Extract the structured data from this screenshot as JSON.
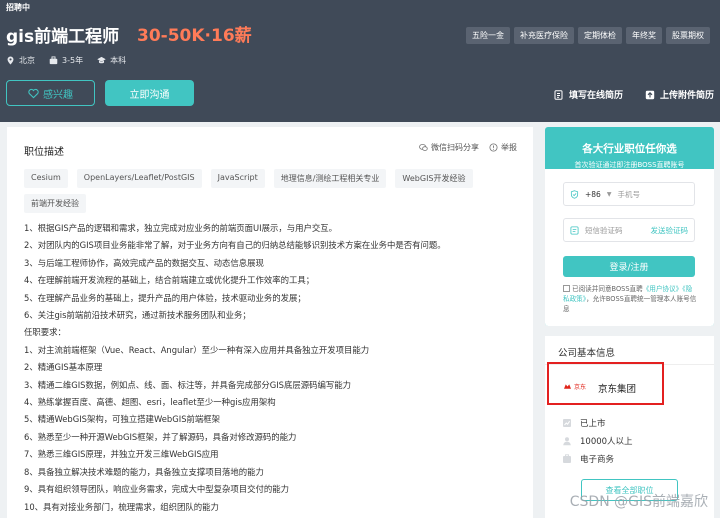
{
  "header": {
    "status": "招聘中",
    "job_title": "gis前端工程师",
    "salary": "30-50K·16薪",
    "meta": {
      "city": "北京",
      "experience": "3-5年",
      "education": "本科"
    },
    "benefits": [
      "五险一金",
      "补充医疗保险",
      "定期体检",
      "年终奖",
      "股票期权"
    ],
    "buttons": {
      "interest": "感兴趣",
      "chat": "立即沟通"
    },
    "resume_links": {
      "online": "填写在线简历",
      "upload": "上传附件简历"
    }
  },
  "job_detail": {
    "section_title": "职位描述",
    "share_label": "微信扫码分享",
    "report_label": "举报",
    "tags": [
      "Cesium",
      "OpenLayers/Leaflet/PostGIS",
      "JavaScript",
      "地理信息/测绘工程相关专业",
      "WebGIS开发经验",
      "前端开发经验"
    ],
    "description": [
      "1、根据GIS产品的逻辑和需求，独立完成对应业务的前端页面UI展示，与用户交互。",
      "2、对团队内的GIS项目业务能非常了解，对于业务方向有自己的归纳总结能够识别技术方案在业务中是否有问题。",
      "3、与后端工程师协作，高效完成产品的数据交互、动态信息展现",
      "4、在理解前端开发流程的基础上，结合前端建立或优化提升工作效率的工具；",
      "5、在理解产品业务的基础上，提升产品的用户体验，技术驱动业务的发展；",
      "6、关注gis前端前沿技术研究，通过新技术服务团队和业务；",
      "任职要求：",
      "1、对主流前端框架（Vue、React、Angular）至少一种有深入应用并具备独立开发项目能力",
      "2、精通GIS基本原理",
      "3、精通二维GIS数据，例如点、线、面、标注等，并具备完成部分GIS底层源码编写能力",
      "4、熟练掌握百度、高德、超图、esri，leaflet至少一种gis应用架构",
      "5、精通WebGIS架构，可独立搭建WebGIS前端框架",
      "6、熟悉至少一种开源WebGIS框架，并了解源码，具备对修改源码的能力",
      "7、熟悉三维GIS原理，并独立开发三维WebGIS应用",
      "8、具备独立解决技术难题的能力，具备独立支撑项目落地的能力",
      "9、具有组织领导团队，响应业务需求，完成大中型复杂项目交付的能力",
      "10、具有对接业务部门，梳理需求，组织团队的能力"
    ]
  },
  "login": {
    "headline": "各大行业职位任你选",
    "subline": "首次验证通过即注册BOSS直聘账号",
    "country_code": "+86",
    "phone_placeholder": "手机号",
    "code_placeholder": "短信验证码",
    "send_code": "发送验证码",
    "submit": "登录/注册",
    "agree_prefix": "已阅读并同意BOSS直聘",
    "agree_link1": "《用户协议》",
    "agree_link2": "《隐私政策》",
    "agree_suffix": "，允许BOSS直聘统一管理本人账号信息"
  },
  "company": {
    "section_title": "公司基本信息",
    "logo_text": "京东",
    "name": "京东集团",
    "listing": "已上市",
    "size": "10000人以上",
    "industry": "电子商务",
    "more_button": "查看全部职位"
  },
  "watermark": "CSDN @GIS前端嘉欣",
  "colors": {
    "banner": "#404a58",
    "accent": "#41c5c2",
    "salary": "#ff7b58",
    "highlight_box": "#e32020"
  }
}
